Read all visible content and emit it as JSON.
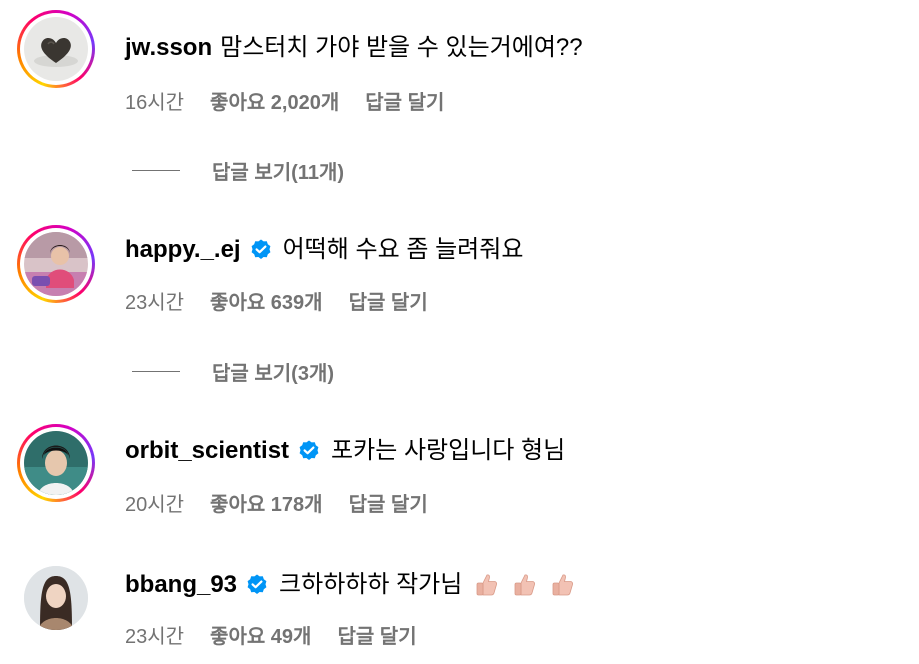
{
  "colors": {
    "text_primary": "#000000",
    "text_secondary": "#737373",
    "verified_blue": "#0095f6",
    "background": "#ffffff"
  },
  "comments": [
    {
      "username": "jw.sson",
      "verified": false,
      "text": "맘스터치 가야 받을 수 있는거에여??",
      "time": "16시간",
      "likes": "좋아요 2,020개",
      "reply_label": "답글 달기",
      "view_replies": "답글 보기(11개)",
      "story_ring": true,
      "avatar_icon": "heart-object-avatar"
    },
    {
      "username": "happy._.ej",
      "verified": true,
      "text": "어떡해 수요 좀 늘려줘요",
      "time": "23시간",
      "likes": "좋아요 639개",
      "reply_label": "답글 달기",
      "view_replies": "답글 보기(3개)",
      "story_ring": true,
      "avatar_icon": "person-photo-avatar"
    },
    {
      "username": "orbit_scientist",
      "verified": true,
      "text": "포카는 사랑입니다 형님",
      "time": "20시간",
      "likes": "좋아요 178개",
      "reply_label": "답글 달기",
      "story_ring": true,
      "avatar_icon": "person-photo-avatar"
    },
    {
      "username": "bbang_93",
      "verified": true,
      "text": "크하하하하 작가님",
      "emojis": [
        "thumbs-up-emoji",
        "thumbs-up-emoji",
        "thumbs-up-emoji"
      ],
      "time": "23시간",
      "likes": "좋아요 49개",
      "reply_label": "답글 달기",
      "story_ring": false,
      "avatar_icon": "person-photo-avatar"
    }
  ]
}
